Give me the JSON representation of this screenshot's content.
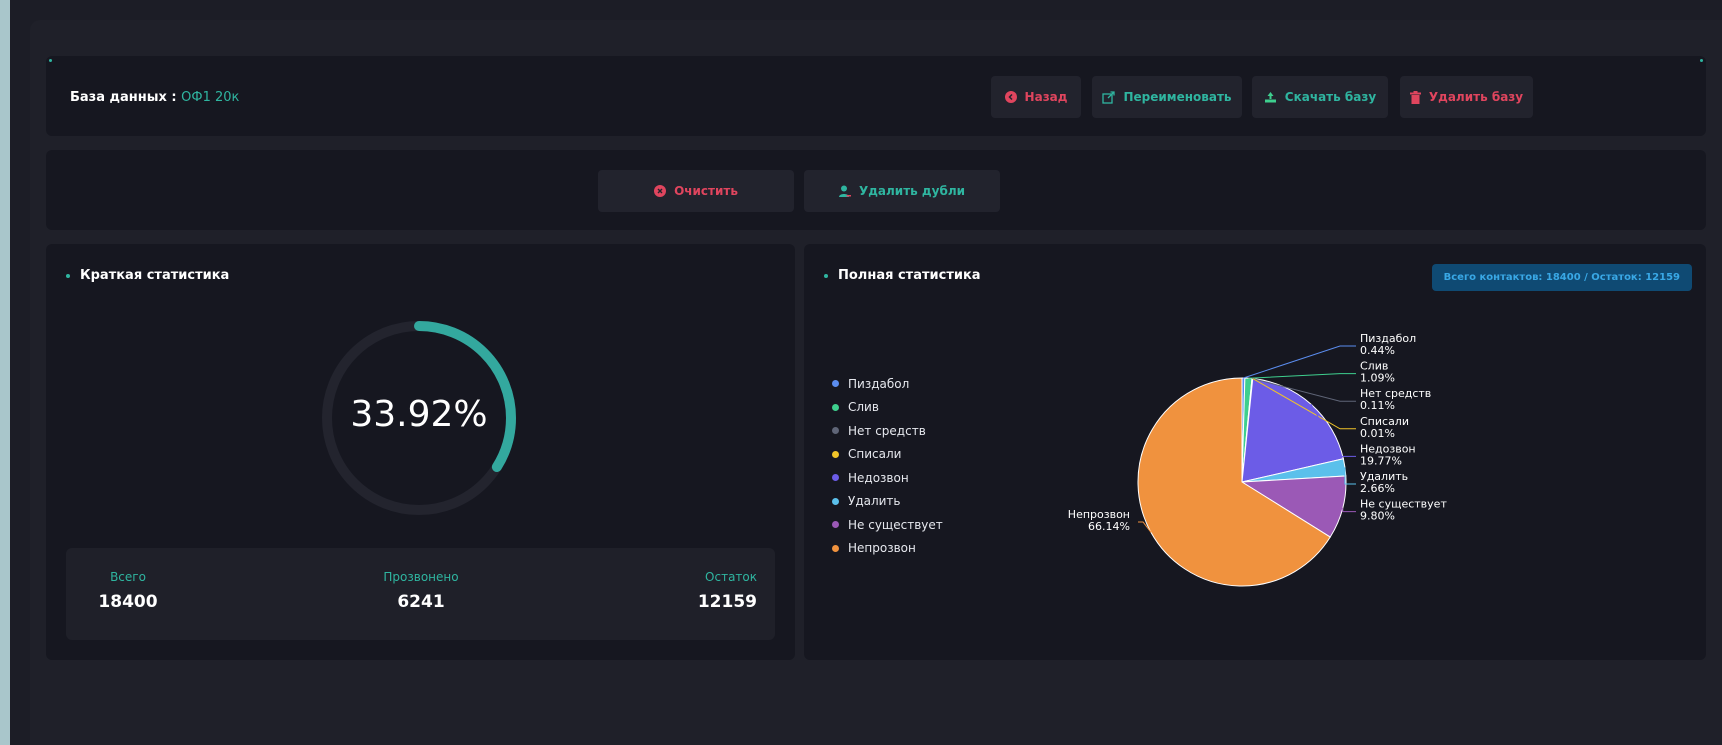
{
  "header": {
    "db_label": "База данных :",
    "db_name": "ОФ1 20к",
    "buttons": {
      "back": "Назад",
      "rename": "Переименовать",
      "download": "Скачать базу",
      "delete": "Удалить базу"
    }
  },
  "actions": {
    "clear": "Очистить",
    "remove_duplicates": "Удалить дубли"
  },
  "brief_stats": {
    "title": "Краткая статистика",
    "percent_text": "33.92%",
    "progress": 0.3392,
    "items": [
      {
        "label": "Всего",
        "value": "18400"
      },
      {
        "label": "Прозвонено",
        "value": "6241"
      },
      {
        "label": "Остаток",
        "value": "12159"
      }
    ]
  },
  "full_stats": {
    "title": "Полная статистика",
    "badge": "Всего контактов: 18400 / Остаток: 12159"
  },
  "chart_data": {
    "type": "pie",
    "series": [
      {
        "name": "Пиздабол",
        "value": 0.44,
        "color": "#5b8def"
      },
      {
        "name": "Слив",
        "value": 1.09,
        "color": "#3ecf8e"
      },
      {
        "name": "Нет средств",
        "value": 0.11,
        "color": "#5f6577"
      },
      {
        "name": "Списали",
        "value": 0.01,
        "color": "#f0c429"
      },
      {
        "name": "Недозвон",
        "value": 19.77,
        "color": "#6c5ce7"
      },
      {
        "name": "Удалить",
        "value": 2.66,
        "color": "#5bc0eb"
      },
      {
        "name": "Не существует",
        "value": 9.8,
        "color": "#9b59b6"
      },
      {
        "name": "Непрозвон",
        "value": 66.14,
        "color": "#f0923e"
      }
    ],
    "labels": [
      {
        "name": "Пиздабол",
        "pct": "0.44%"
      },
      {
        "name": "Слив",
        "pct": "1.09%"
      },
      {
        "name": "Нет средств",
        "pct": "0.11%"
      },
      {
        "name": "Списали",
        "pct": "0.01%"
      },
      {
        "name": "Недозвон",
        "pct": "19.77%"
      },
      {
        "name": "Удалить",
        "pct": "2.66%"
      },
      {
        "name": "Не существует",
        "pct": "9.80%"
      },
      {
        "name": "Непрозвон",
        "pct": "66.14%"
      }
    ],
    "legend_position": "left"
  },
  "colors": {
    "accent": "#2fb5a0",
    "danger": "#e0455e",
    "badge_bg": "#0f4a73",
    "badge_text": "#39a8e6"
  },
  "icons": {
    "back": "circle-back-icon",
    "rename": "external-edit-icon",
    "download": "upload-tray-icon",
    "delete": "trash-icon",
    "clear": "circle-x-icon",
    "remove_duplicates": "user-remove-icon"
  }
}
